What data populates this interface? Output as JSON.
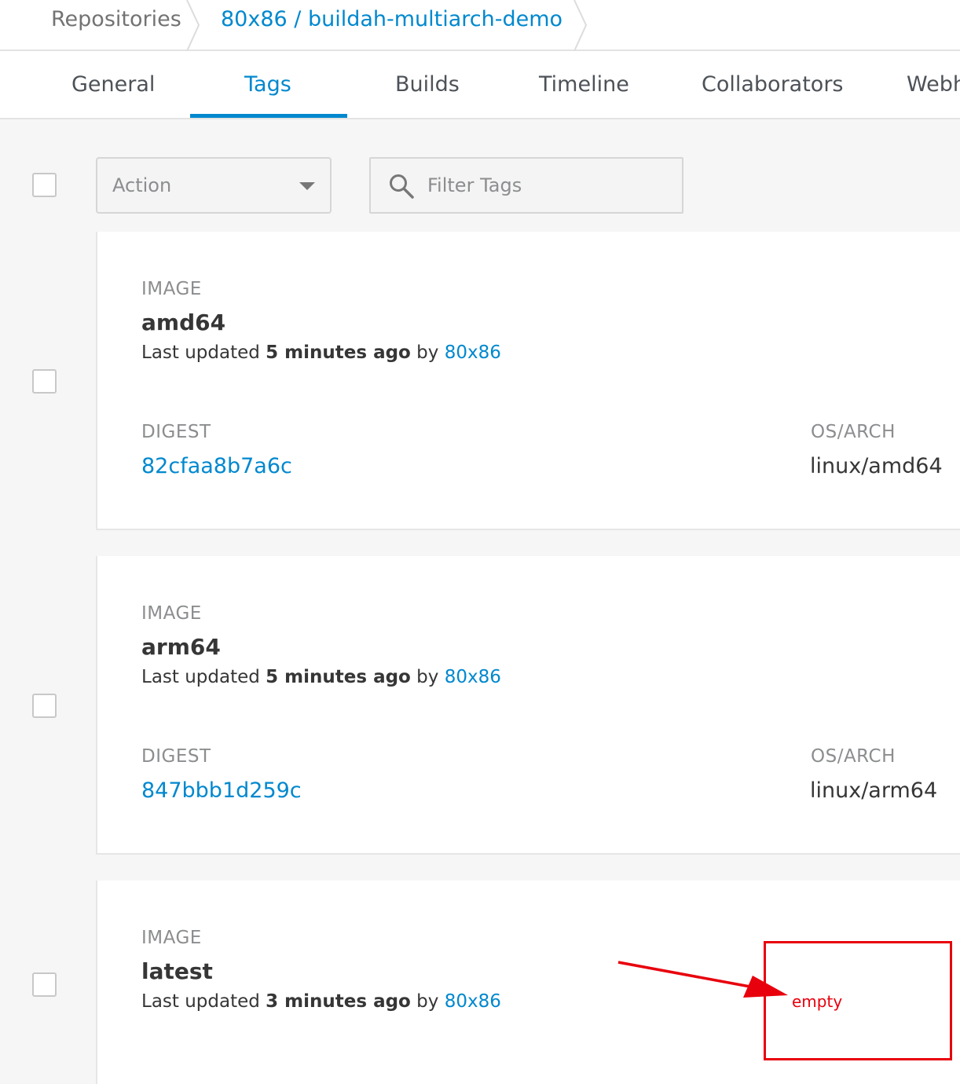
{
  "breadcrumb": {
    "repositories": "Repositories",
    "current": "80x86 / buildah-multiarch-demo"
  },
  "tabs": [
    {
      "label": "General"
    },
    {
      "label": "Tags",
      "active": true
    },
    {
      "label": "Builds"
    },
    {
      "label": "Timeline"
    },
    {
      "label": "Collaborators"
    },
    {
      "label": "Webh"
    }
  ],
  "toolbar": {
    "action_label": "Action",
    "filter_placeholder": "Filter Tags"
  },
  "labels": {
    "image": "IMAGE",
    "digest": "DIGEST",
    "os_arch": "OS/ARCH",
    "last_updated": "Last updated",
    "by": "by"
  },
  "tags": [
    {
      "name": "amd64",
      "updated": "5 minutes ago",
      "user": "80x86",
      "digest": "82cfaa8b7a6c",
      "os_arch": "linux/amd64"
    },
    {
      "name": "arm64",
      "updated": "5 minutes ago",
      "user": "80x86",
      "digest": "847bbb1d259c",
      "os_arch": "linux/arm64"
    },
    {
      "name": "latest",
      "updated": "3 minutes ago",
      "user": "80x86"
    }
  ],
  "annotation": {
    "text": "empty",
    "color": "#e8000c"
  },
  "colors": {
    "accent": "#0088ce",
    "background": "#f6f6f6"
  }
}
